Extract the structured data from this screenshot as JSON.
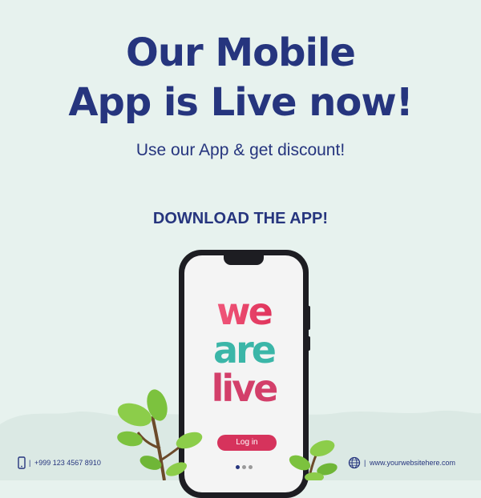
{
  "headline": {
    "line1": "Our Mobile",
    "line2": "App is Live now!"
  },
  "subtitle": "Use our App & get discount!",
  "cta": "DOWNLOAD THE APP!",
  "phone_screen": {
    "logo_lines": [
      "we",
      "are",
      "live"
    ],
    "login_label": "Log in",
    "carousel": {
      "count": 3,
      "active_index": 0
    }
  },
  "footer": {
    "phone_number": "+999 123 4567 8910",
    "website": "www.yourwebsitehere.com",
    "phone_icon": "smartphone-icon",
    "web_icon": "globe-icon",
    "separator": "|"
  },
  "colors": {
    "background": "#e7f2ee",
    "brand_navy": "#26357e",
    "login_button": "#d6335c",
    "leaf_green": "#7cc23e"
  }
}
